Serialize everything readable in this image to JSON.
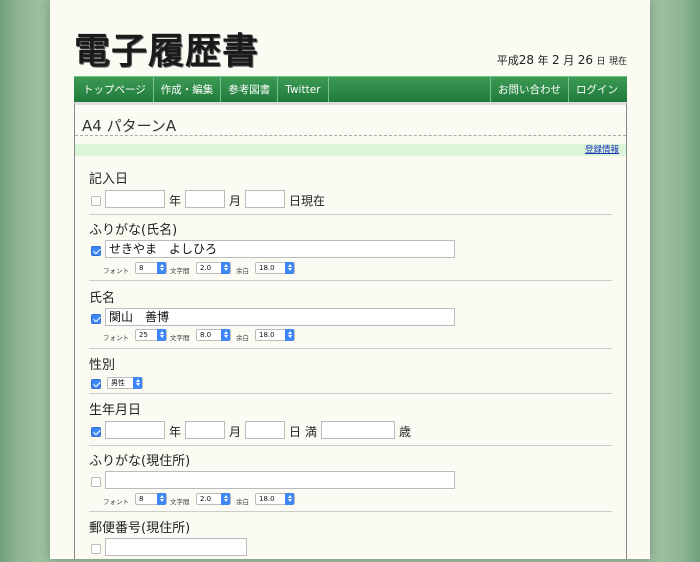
{
  "header": {
    "logo_text": "電子履歴書",
    "date": {
      "era": "平成",
      "year": "28",
      "year_unit": "年",
      "month": "2",
      "month_unit": "月",
      "day": "26",
      "day_unit": "日",
      "suffix": "現在"
    }
  },
  "nav": {
    "left": [
      "トップページ",
      "作成・編集",
      "参考図書",
      "Twitter"
    ],
    "right": [
      "お問い合わせ",
      "ログイン"
    ]
  },
  "page": {
    "pattern_title": "A4 パターンA",
    "register_link": "登録情報"
  },
  "labels": {
    "font": "フォント",
    "spacing": "文字間",
    "margin": "余白",
    "year": "年",
    "month": "月",
    "day_present": "日現在",
    "day": "日",
    "man": "満",
    "age": "歳"
  },
  "sections": {
    "entry_date": {
      "label": "記入日",
      "checked": false,
      "year": "",
      "month": "",
      "day": ""
    },
    "furigana_name": {
      "label": "ふりがな(氏名)",
      "checked": true,
      "value": "せきやま　よしひろ",
      "font": "8",
      "spacing": "2.0",
      "margin": "18.0"
    },
    "name": {
      "label": "氏名",
      "checked": true,
      "value": "関山　善博",
      "font": "25",
      "spacing": "8.0",
      "margin": "18.0"
    },
    "gender": {
      "label": "性別",
      "checked": true,
      "value": "男性"
    },
    "birthdate": {
      "label": "生年月日",
      "checked": true,
      "year": "",
      "month": "",
      "day": "",
      "age": ""
    },
    "furigana_address": {
      "label": "ふりがな(現住所)",
      "checked": false,
      "value": "",
      "font": "8",
      "spacing": "2.0",
      "margin": "18.0"
    },
    "postal_code": {
      "label": "郵便番号(現住所)",
      "checked": false,
      "value": ""
    }
  },
  "colors": {
    "nav_green": "#2a8a45",
    "checkbox_blue": "#3d86f5",
    "register_bar": "#dbf5db",
    "link_blue": "#1a35b8"
  }
}
